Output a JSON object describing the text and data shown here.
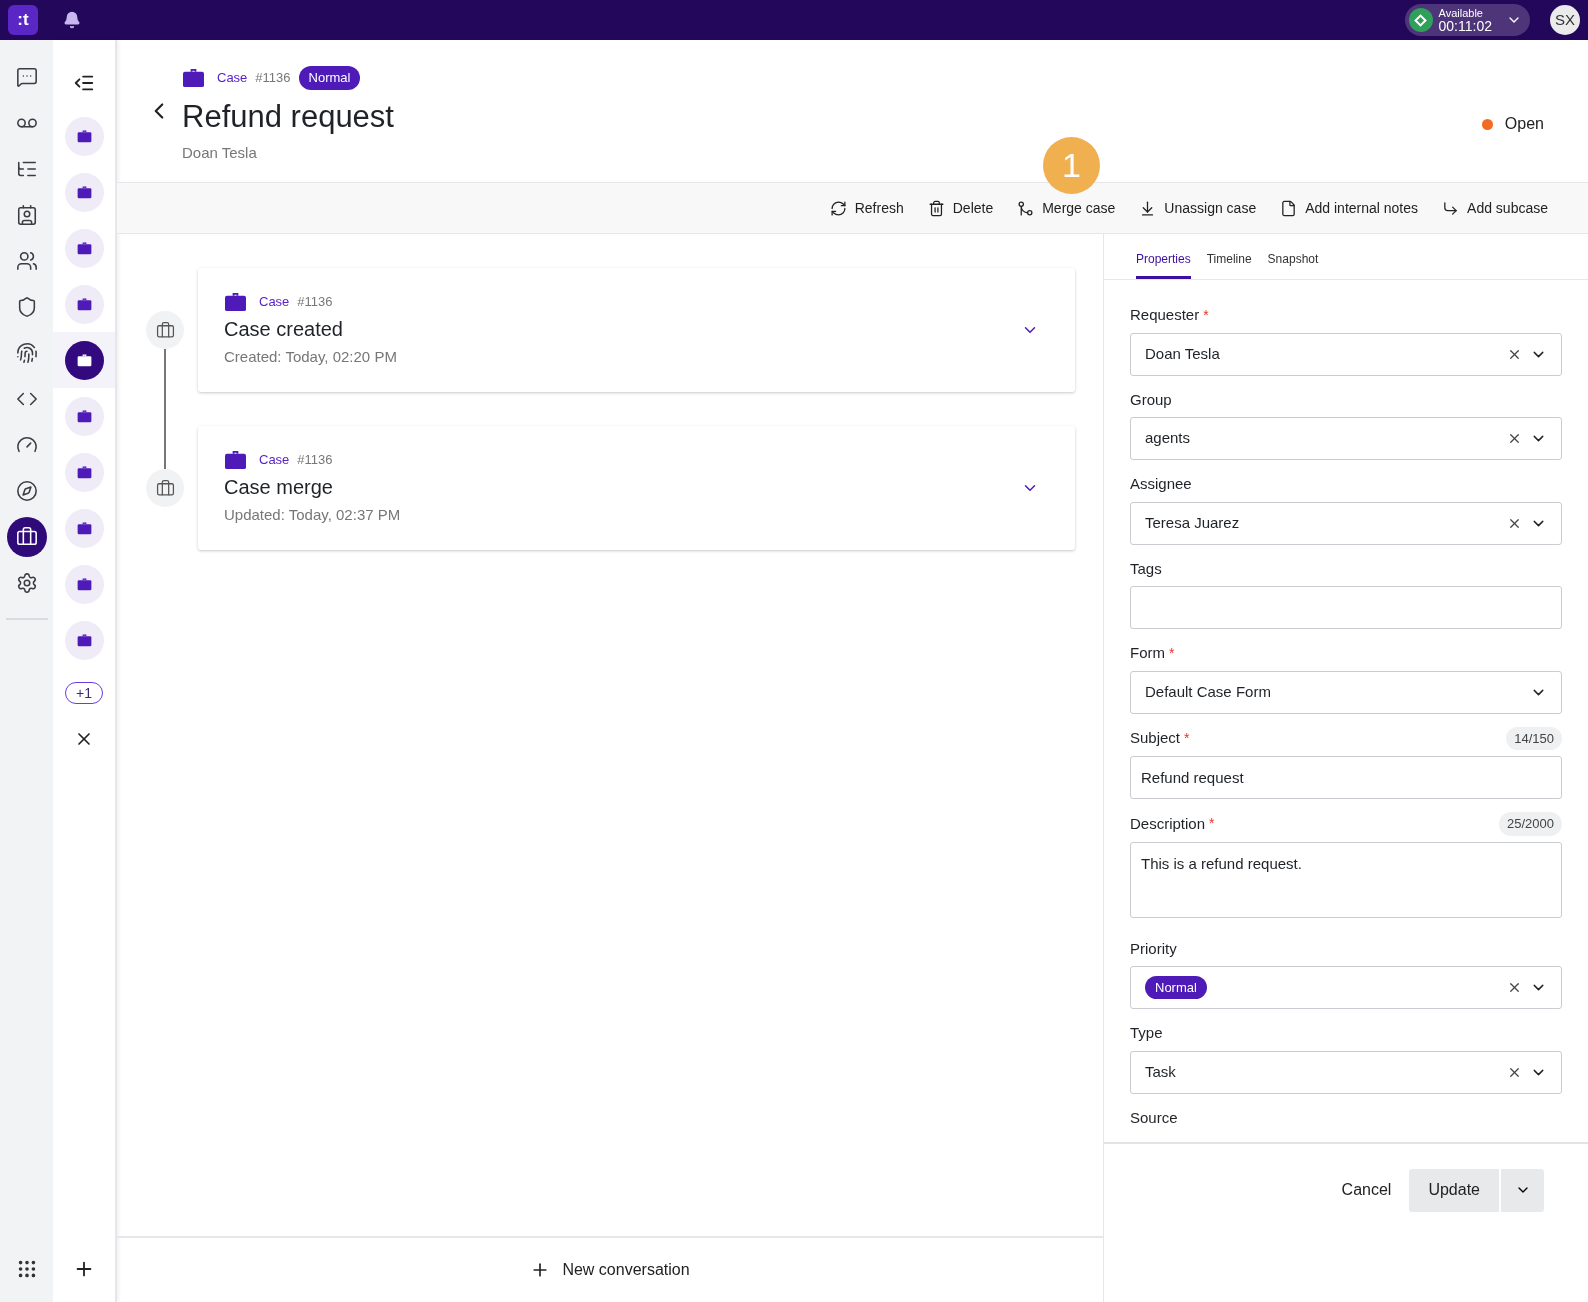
{
  "topbar": {
    "logo": ":t",
    "status": {
      "label": "Available",
      "timer": "00:11:02"
    },
    "avatar": "SX"
  },
  "rail": [
    {
      "selected": false
    },
    {
      "selected": false
    },
    {
      "selected": false
    },
    {
      "selected": false
    },
    {
      "selected": false
    },
    {
      "selected": false
    },
    {
      "selected": false
    },
    {
      "selected": false
    },
    {
      "selected": false
    },
    {
      "selected": false
    },
    {
      "selected": true
    },
    {
      "selected": false
    }
  ],
  "case_tabs": [
    {
      "selected": false
    },
    {
      "selected": false
    },
    {
      "selected": false
    },
    {
      "selected": false
    },
    {
      "selected": true
    },
    {
      "selected": false
    },
    {
      "selected": false
    },
    {
      "selected": false
    },
    {
      "selected": false
    },
    {
      "selected": false
    }
  ],
  "more_count": "+1",
  "header": {
    "type": "Case",
    "number": "#1136",
    "priority": "Normal",
    "title": "Refund request",
    "requester": "Doan Tesla",
    "status": {
      "label": "Open",
      "color": "#f26b21"
    }
  },
  "annotation": "1",
  "toolbar": [
    "Refresh",
    "Delete",
    "Merge case",
    "Unassign case",
    "Add internal notes",
    "Add subcase"
  ],
  "timeline": [
    {
      "type": "Case",
      "number": "#1136",
      "title": "Case created",
      "meta": "Created: Today, 02:20 PM"
    },
    {
      "type": "Case",
      "number": "#1136",
      "title": "Case merge",
      "meta": "Updated: Today, 02:37 PM"
    }
  ],
  "tabs": [
    {
      "label": "Properties",
      "selected": true
    },
    {
      "label": "Timeline",
      "selected": false
    },
    {
      "label": "Snapshot",
      "selected": false
    }
  ],
  "fields": [
    {
      "label": "Requester",
      "required_mark": "*",
      "kind": "select",
      "value": "Doan Tesla",
      "clearable": true
    },
    {
      "label": "Group",
      "kind": "select",
      "value": "agents",
      "clearable": true
    },
    {
      "label": "Assignee",
      "kind": "select",
      "value": "Teresa Juarez",
      "clearable": true
    },
    {
      "label": "Tags",
      "kind": "text"
    },
    {
      "label": "Form",
      "required_mark": "*",
      "kind": "select",
      "value": "Default Case Form",
      "clearable": false
    },
    {
      "label": "Subject",
      "required_mark": "*",
      "kind": "text",
      "value": "Refund request",
      "counter": "14/150"
    },
    {
      "label": "Description",
      "required_mark": "*",
      "kind": "textarea",
      "value": "This is a refund request.",
      "counter": "25/2000"
    },
    {
      "label": "Priority",
      "kind": "chip-select",
      "value": "Normal",
      "clearable": true
    },
    {
      "label": "Type",
      "kind": "select",
      "value": "Task",
      "clearable": true
    },
    {
      "label": "Source",
      "kind": "label-only"
    }
  ],
  "actions": {
    "cancel": "Cancel",
    "submit": "Update"
  },
  "new_conversation": "New conversation"
}
